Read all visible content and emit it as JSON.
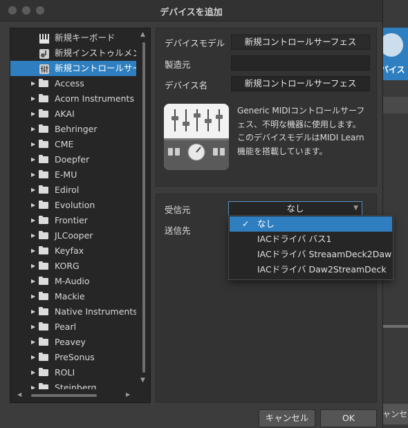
{
  "window": {
    "title": "デバイスを追加"
  },
  "background": {
    "label": "バイス",
    "cancel_label": "ャンセ"
  },
  "tree": {
    "templates": [
      {
        "label": "新規キーボード",
        "icon": "piano-keys-icon"
      },
      {
        "label": "新規インストゥルメン",
        "icon": "instrument-icon"
      },
      {
        "label": "新規コントロールサー",
        "icon": "mixer-icon",
        "selected": true
      }
    ],
    "vendors": [
      "Access",
      "Acorn Instruments",
      "AKAI",
      "Behringer",
      "CME",
      "Doepfer",
      "E-MU",
      "Edirol",
      "Evolution",
      "Frontier",
      "JLCooper",
      "Keyfax",
      "KORG",
      "M-Audio",
      "Mackie",
      "Native Instruments",
      "Pearl",
      "Peavey",
      "PreSonus",
      "ROLI",
      "Steinberg"
    ]
  },
  "device": {
    "model_label": "デバイスモデル",
    "model_value": "新規コントロールサーフェス",
    "maker_label": "製造元",
    "maker_value": "",
    "name_label": "デバイス名",
    "name_value": "新規コントロールサーフェス",
    "description": "Generic MIDIコントロールサーフェス、不明な機器に使用します。このデバイスモデルはMIDI Learn機能を搭載しています。"
  },
  "ports": {
    "receive_label": "受信元",
    "receive_value": "なし",
    "send_label": "送信先",
    "dropdown_options": [
      {
        "label": "なし",
        "checked": true
      },
      {
        "label": "IACドライバ バス1"
      },
      {
        "label": "IACドライバ StreaamDeck2Daw"
      },
      {
        "label": "IACドライバ Daw2StreamDeck"
      }
    ]
  },
  "buttons": {
    "cancel": "キャンセル",
    "ok": "OK"
  },
  "colors": {
    "accent": "#2f7fc0",
    "window_bg": "#3c3c3c",
    "panel_bg": "#333333"
  }
}
